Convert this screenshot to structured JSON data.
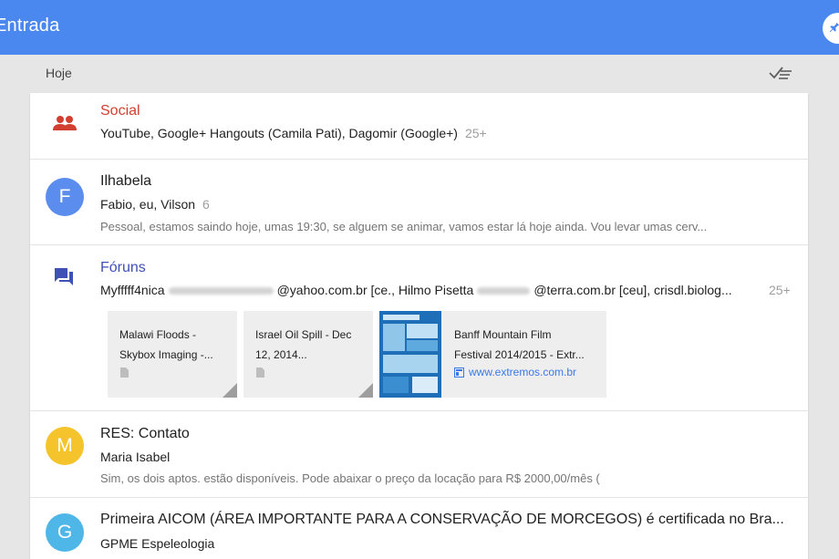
{
  "app": {
    "title": "Entrada",
    "primary_color": "#4a87ee"
  },
  "section": {
    "label": "Hoje"
  },
  "items": [
    {
      "type": "bundle",
      "icon": "people-icon",
      "title": "Social",
      "senders": "YouTube, Google+ Hangouts (Camila Pati), Dagomir (Google+)",
      "count": "25+"
    },
    {
      "type": "thread",
      "avatar_letter": "F",
      "avatar_color": "#5b8def",
      "title": "Ilhabela",
      "senders": "Fabio, eu, Vilson",
      "count": "6",
      "snippet": "Pessoal, estamos saindo hoje, umas 19:30, se alguem se animar, vamos estar lá hoje ainda. Vou levar umas cerv..."
    },
    {
      "type": "bundle",
      "icon": "forum-icon",
      "title": "Fóruns",
      "senders_start": "Myfffff4nica",
      "senders_mid1": "@yahoo.com.br [ce., Hilmo Pisetta",
      "senders_mid2": "@terra.com.br [ceu], crisdl.biolog...",
      "count": "25+",
      "cards": [
        {
          "line1": "Malawi Floods -",
          "line2": "Skybox Imaging -..."
        },
        {
          "line1": "Israel Oil Spill - Dec",
          "line2": "12, 2014..."
        },
        {
          "line1": "Banff Mountain Film",
          "line2": "Festival 2014/2015 - Extr...",
          "link": "www.extremos.com.br"
        }
      ]
    },
    {
      "type": "thread",
      "avatar_letter": "M",
      "avatar_color": "#f5c42c",
      "title": "RES: Contato",
      "senders": "Maria Isabel",
      "snippet": "Sim, os dois aptos. estão disponíveis. Pode abaixar o preço da locação para R$ 2000,00/mês ("
    },
    {
      "type": "thread",
      "avatar_letter": "G",
      "avatar_color": "#4fb7e8",
      "title": "Primeira AICOM (ÁREA IMPORTANTE PARA A CONSERVAÇÃO DE MORCEGOS) é certificada no Bra...",
      "senders": "GPME Espeleologia"
    }
  ]
}
